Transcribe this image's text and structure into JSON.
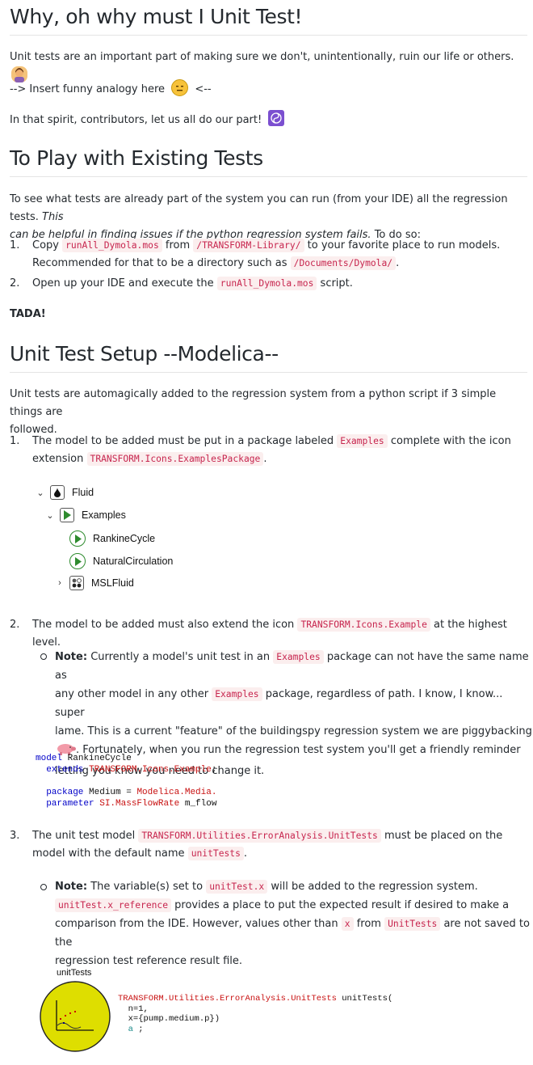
{
  "sections": {
    "why_title": "Why, oh why must I Unit Test!",
    "why_p1": "Unit tests are an important part of making sure we don't, unintentionally, ruin our life or others.",
    "why_p2_a": "--> Insert funny analogy here",
    "why_p2_b": "<--",
    "why_p3": "In that spirit, contributors, let us all do our part!",
    "play_title": "To Play with Existing Tests",
    "play_p_a": "To see what tests are already part of the system you can run (from your IDE) all the regression tests.",
    "play_p_b": "This",
    "play_p_c": "can be helpful in finding issues if the python regression system fails.",
    "play_p_d": "To do so:",
    "play_li1_a": "Copy",
    "play_li1_code1": "runAll_Dymola.mos",
    "play_li1_b": "from",
    "play_li1_code2": "/TRANSFORM-Library/",
    "play_li1_c": "to your favorite place to run models.",
    "play_li1_d": "Recommended for that to be a directory such as",
    "play_li1_code3": "/Documents/Dymola/",
    "play_li1_e": ".",
    "play_li2_a": "Open up your IDE and execute the",
    "play_li2_code": "runAll_Dymola.mos",
    "play_li2_b": "script.",
    "tada": "TADA!",
    "setup_title": "Unit Test Setup --Modelica--",
    "setup_p_a": "Unit tests are automagically added to the regression system from a python script if 3 simple things are",
    "setup_p_b": "followed.",
    "s1_a": "The model to be added must be put in a package labeled",
    "s1_code1": "Examples",
    "s1_b": "complete with the icon",
    "s1_c": "extension",
    "s1_code2": "TRANSFORM.Icons.ExamplesPackage",
    "s1_d": ".",
    "tree": {
      "fluid": "Fluid",
      "examples": "Examples",
      "rankine": "RankineCycle",
      "natural": "NaturalCirculation",
      "mslfluid": "MSLFluid"
    },
    "s2_a": "The model to be added must also extend the icon",
    "s2_code": "TRANSFORM.Icons.Example",
    "s2_b": "at the highest level.",
    "note1_label": "Note:",
    "note1_a": "Currently a model's unit test in an",
    "note1_code1": "Examples",
    "note1_b": "package can not have the same name as",
    "note1_c": "any other model in any other",
    "note1_code2": "Examples",
    "note1_d": "package, regardless of path. I know, I know... super",
    "note1_e": "lame. This is a current \"feature\" of the buildingspy regression system we are piggybacking",
    "note1_f": ". Fortunately, when you run the regression test system you'll get a friendly reminder",
    "note1_g": "letting you know you need to change it.",
    "code1": {
      "l1_kw": "model",
      "l1_rest": " RankineCycle",
      "l2_kw": "  extends",
      "l2_red": " TRANSFORM.Icons.Example",
      "l2_rest": ";",
      "l3_kw": "  package",
      "l3_rest": " Medium = ",
      "l3_red": "Modelica.Media.",
      "l4_kw": "  parameter",
      "l4_red": " SI.MassFlowRate",
      "l4_rest": " m_flow"
    },
    "s3_a": "The unit test model",
    "s3_code1": "TRANSFORM.Utilities.ErrorAnalysis.UnitTests",
    "s3_b": "must be placed on the",
    "s3_c": "model with the default name",
    "s3_code2": "unitTests",
    "s3_d": ".",
    "note2_label": "Note:",
    "note2_a": "The variable(s) set to",
    "note2_code1": "unitTest.x",
    "note2_b": "will be added to the regression system.",
    "note2_code2": "unitTest.x_reference",
    "note2_c": "provides a place to put the expected result if desired to make a",
    "note2_d": "comparison from the IDE. However, values other than",
    "note2_code3": "x",
    "note2_e": "from",
    "note2_code4": "UnitTests",
    "note2_f": "are not saved to the",
    "note2_g": "regression test reference result file.",
    "unit_label": "unitTests",
    "code2": {
      "l1_red": "TRANSFORM.Utilities.ErrorAnalysis.UnitTests",
      "l1_rest": " unitTests(",
      "l2": "  n=1,",
      "l3": "  x={pump.medium.p})",
      "l4_teal": "  a",
      "l4_rest": " ;"
    }
  },
  "colors": {
    "code_text": "#c7254e",
    "code_bg": "#fbeeee",
    "unittest_circle": "#dede00",
    "play_green": "#2e8b2e"
  }
}
